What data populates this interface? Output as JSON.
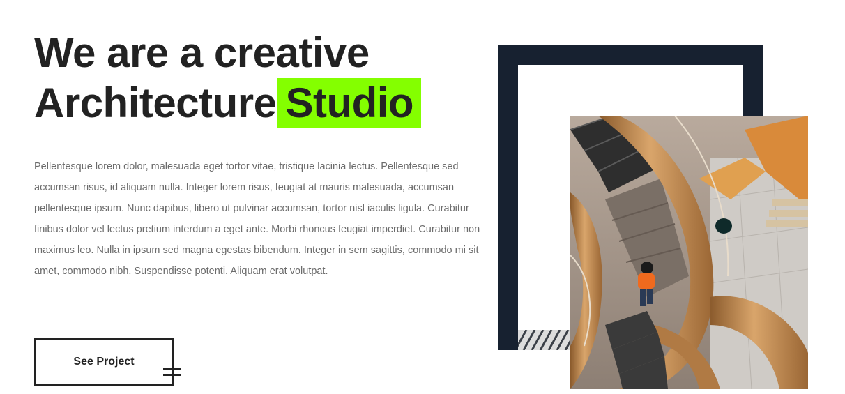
{
  "hero": {
    "title_line1": "We are a creative",
    "title_line2_main": "Architecture",
    "title_line2_highlight": "Studio",
    "paragraph": "Pellentesque lorem dolor, malesuada eget tortor vitae, tristique lacinia lectus. Pellentesque sed accumsan risus, id aliquam nulla. Integer lorem risus, feugiat at mauris malesuada, accumsan pellentesque ipsum. Nunc dapibus, libero ut pulvinar accumsan, tortor nisl iaculis ligula. Curabitur finibus dolor vel lectus pretium interdum a eget ante. Morbi rhoncus feugiat imperdiet. Curabitur non maximus leo. Nulla in ipsum sed magna egestas bibendum. Integer in sem sagittis, commodo mi sit amet, commodo nibh. Suspendisse potenti. Aliquam erat volutpat.",
    "button_label": "See Project"
  },
  "colors": {
    "highlight": "#84ff00",
    "frame": "#172130",
    "text_dark": "#222222",
    "text_body": "#6b6b6b",
    "wood": "#c48a4e"
  },
  "media": {
    "photo_subject": "spiral-staircase-photo",
    "frame_decor": "square-frame"
  }
}
